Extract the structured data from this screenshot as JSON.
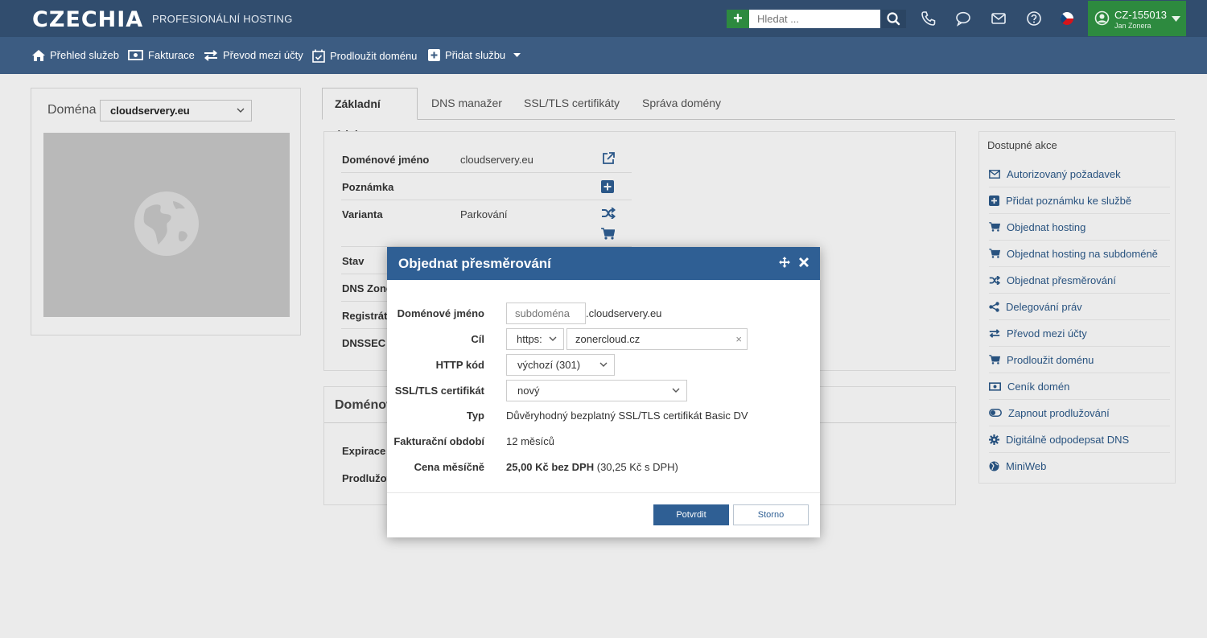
{
  "header": {
    "logo": "CZECHIA",
    "tagline": "PROFESIONÁLNÍ HOSTING",
    "search_placeholder": "Hledat ...",
    "account_id": "CZ-155013",
    "account_name": "Jan Zonera"
  },
  "nav": {
    "items": [
      {
        "label": "Přehled služeb"
      },
      {
        "label": "Fakturace"
      },
      {
        "label": "Převod mezi účty"
      },
      {
        "label": "Prodloužit doménu"
      },
      {
        "label": "Přidat službu"
      }
    ]
  },
  "sidebar": {
    "domain_label": "Doména",
    "selected_domain": "cloudservery.eu"
  },
  "tabs": [
    {
      "label": "Základní údaje",
      "active": true
    },
    {
      "label": "DNS manažer"
    },
    {
      "label": "SSL/TLS certifikáty"
    },
    {
      "label": "Správa domény"
    }
  ],
  "details": {
    "rows": [
      {
        "label": "Doménové jméno",
        "value": "cloudservery.eu"
      },
      {
        "label": "Poznámka",
        "value": ""
      },
      {
        "label": "Varianta",
        "value": "Parkování"
      },
      {
        "label": "Stav",
        "value": ""
      },
      {
        "label": "DNS Zone",
        "value": ""
      },
      {
        "label": "Registráto",
        "value": ""
      },
      {
        "label": "DNSSEC Z",
        "value": ""
      }
    ],
    "panel2_title": "Doménov",
    "panel2_rows": [
      {
        "label": "Expirace"
      },
      {
        "label": "Prodlužov"
      }
    ]
  },
  "actions": {
    "title": "Dostupné akce",
    "items": [
      {
        "label": "Autorizovaný požadavek",
        "icon": "envelope-icon"
      },
      {
        "label": "Přidat poznámku ke službě",
        "icon": "plus-square-icon"
      },
      {
        "label": "Objednat hosting",
        "icon": "cart-icon"
      },
      {
        "label": "Objednat hosting na subdoméně",
        "icon": "cart-icon"
      },
      {
        "label": "Objednat přesměrování",
        "icon": "shuffle-icon"
      },
      {
        "label": "Delegování práv",
        "icon": "share-icon"
      },
      {
        "label": "Převod mezi účty",
        "icon": "exchange-icon"
      },
      {
        "label": "Prodloužit doménu",
        "icon": "cart-icon"
      },
      {
        "label": "Ceník domén",
        "icon": "money-icon"
      },
      {
        "label": "Zapnout prodlužování",
        "icon": "toggle-icon"
      },
      {
        "label": "Digitálně odpodepsat DNS",
        "icon": "gear-icon"
      },
      {
        "label": "MiniWeb",
        "icon": "globe-icon"
      }
    ]
  },
  "modal": {
    "title": "Objednat přesměrování",
    "domain_label": "Doménové jméno",
    "subdomain_placeholder": "subdoména",
    "domain_suffix": ".cloudservery.eu",
    "target_label": "Cíl",
    "protocol": "https:",
    "target_value": "zonercloud.cz",
    "http_code_label": "HTTP kód",
    "http_code": "výchozí (301)",
    "ssl_label": "SSL/TLS certifikát",
    "ssl_value": "nový",
    "type_label": "Typ",
    "type_value": "Důvěryhodný bezplatný SSL/TLS certifikát Basic DV",
    "billing_label": "Fakturační období",
    "billing_value": "12 měsíců",
    "price_label": "Cena měsíčně",
    "price_bold": "25,00 Kč bez DPH",
    "price_extra": "(30,25 Kč s DPH)",
    "confirm_label": "Potvrdit",
    "cancel_label": "Storno"
  },
  "colors": {
    "topbar": "#314d6e",
    "navbar": "#3c5c82",
    "accent_green": "#2d8a3f",
    "modal_header": "#2f5f94",
    "link": "#2c5a8a"
  }
}
